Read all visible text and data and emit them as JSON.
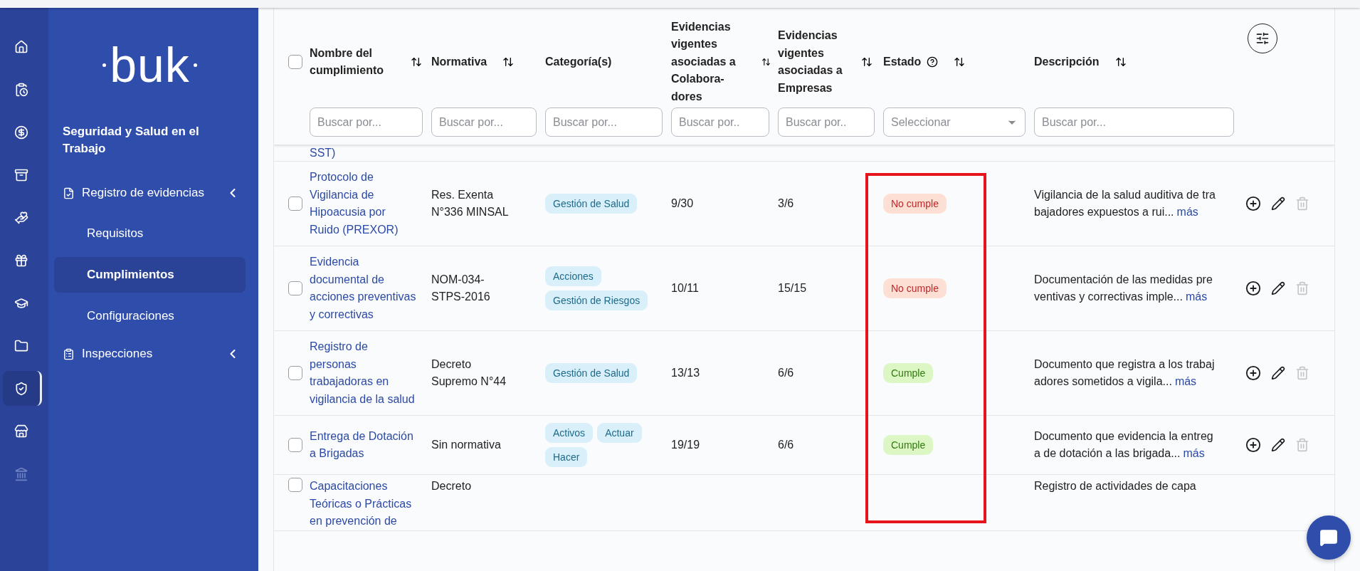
{
  "rail": [
    {
      "selected": false,
      "disabled": false
    },
    {
      "selected": false,
      "disabled": false
    },
    {
      "selected": false,
      "disabled": false
    },
    {
      "selected": false,
      "disabled": false
    },
    {
      "selected": false,
      "disabled": false
    },
    {
      "selected": false,
      "disabled": false
    },
    {
      "selected": false,
      "disabled": false
    },
    {
      "selected": false,
      "disabled": false
    },
    {
      "selected": true,
      "disabled": false
    },
    {
      "selected": false,
      "disabled": false
    },
    {
      "selected": false,
      "disabled": true
    }
  ],
  "sidebar": {
    "logo": "buk",
    "section_title": "Seguridad y Salud en el Trabajo",
    "items": [
      {
        "label": "Registro de evidencias",
        "children": [
          {
            "label": "Requisitos",
            "selected": false
          },
          {
            "label": "Cumplimientos",
            "selected": true
          },
          {
            "label": "Configuraciones",
            "selected": false
          }
        ]
      },
      {
        "label": "Inspecciones"
      }
    ]
  },
  "table": {
    "select_all_checked": false,
    "columns": [
      {
        "label": "Nombre del cumplimiento",
        "sortable": true,
        "help": false,
        "filter": {
          "kind": "text",
          "placeholder": "Buscar por..."
        }
      },
      {
        "label": "Normativa",
        "sortable": true,
        "help": false,
        "filter": {
          "kind": "text",
          "placeholder": "Buscar por..."
        }
      },
      {
        "label": "Categoría(s)",
        "sortable": false,
        "help": false,
        "filter": {
          "kind": "text",
          "placeholder": "Buscar por..."
        }
      },
      {
        "label": "Evidencias vigentes asociadas a Colabora-dores",
        "sortable": true,
        "help": false,
        "filter": {
          "kind": "text",
          "placeholder": "Buscar por.."
        }
      },
      {
        "label": "Evidencias vigentes asociadas a Empresas",
        "sortable": true,
        "help": false,
        "filter": {
          "kind": "text",
          "placeholder": "Buscar por.."
        }
      },
      {
        "label": "Estado",
        "sortable": true,
        "help": true,
        "filter": {
          "kind": "select",
          "placeholder": "Seleccionar"
        }
      },
      {
        "label": "Descripción",
        "sortable": true,
        "help": false,
        "filter": {
          "kind": "text",
          "placeholder": "Buscar por..."
        }
      }
    ],
    "rows": [
      {
        "kind": "partial",
        "name": "SST)"
      },
      {
        "kind": "full",
        "checked": false,
        "name": "Protocolo de Vigilancia de Hipoacusia por Ruido (PREXOR)",
        "normativa": "Res. Exenta N°336 MINSAL",
        "categories": [
          "Gestión de Salud"
        ],
        "colab": "9/30",
        "empresas": "3/6",
        "status": {
          "label": "No cumple",
          "kind": "fail"
        },
        "description": "Vigilancia de la salud auditiva de trabajadores expuestos a rui...",
        "more": "más",
        "can_delete": false
      },
      {
        "kind": "full",
        "checked": false,
        "name": "Evidencia documental de acciones preventivas y correctivas",
        "normativa": "NOM-034-STPS-2016",
        "categories": [
          "Acciones",
          "Gestión de Riesgos"
        ],
        "colab": "10/11",
        "empresas": "15/15",
        "status": {
          "label": "No cumple",
          "kind": "fail"
        },
        "description": "Documentación de las medidas preventivas y correctivas imple...",
        "more": "más",
        "can_delete": false
      },
      {
        "kind": "full",
        "checked": false,
        "name": "Registro de personas trabajadoras en vigilancia de la salud",
        "normativa": "Decreto Supremo N°44",
        "categories": [
          "Gestión de Salud"
        ],
        "colab": "13/13",
        "empresas": "6/6",
        "status": {
          "label": "Cumple",
          "kind": "pass"
        },
        "description": "Documento que registra a los trabajadores sometidos a vigila...",
        "more": "más",
        "can_delete": false
      },
      {
        "kind": "full",
        "checked": false,
        "name": "Entrega de Dotación a Brigadas",
        "normativa": "Sin normativa",
        "categories": [
          "Activos",
          "Actuar",
          "Hacer"
        ],
        "colab": "19/19",
        "empresas": "6/6",
        "status": {
          "label": "Cumple",
          "kind": "pass"
        },
        "description": "Documento que evidencia la entrega de dotación a las brigada...",
        "more": "más",
        "can_delete": false
      },
      {
        "kind": "cut",
        "checked": false,
        "name": "Capacitaciones Teóricas o Prácticas en prevención de",
        "normativa": "Decreto",
        "description": "Registro de actividades de capa"
      }
    ]
  }
}
